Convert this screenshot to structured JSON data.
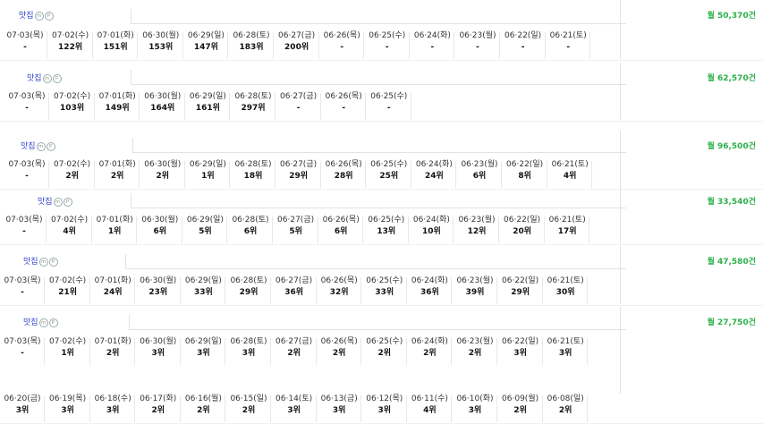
{
  "blocks": [
    {
      "keyword": "맛집",
      "badges": [
        "m",
        "P"
      ],
      "volume": "월 50,370건",
      "rows": [
        [
          [
            "07·03(목)",
            "-"
          ],
          [
            "07·02(수)",
            "122위"
          ],
          [
            "07·01(화)",
            "151위"
          ],
          [
            "06·30(월)",
            "153위"
          ],
          [
            "06·29(일)",
            "147위"
          ],
          [
            "06·28(토)",
            "183위"
          ],
          [
            "06·27(금)",
            "200위"
          ],
          [
            "06·26(목)",
            "-"
          ],
          [
            "06·25(수)",
            "-"
          ],
          [
            "06·24(화)",
            "-"
          ],
          [
            "06·23(월)",
            "-"
          ],
          [
            "06·22(일)",
            "-"
          ],
          [
            "06·21(토)",
            "-"
          ]
        ]
      ]
    },
    {
      "keyword": "맛집",
      "badges": [
        "m",
        "P"
      ],
      "volume": "월 62,570건",
      "rows": [
        [
          [
            "07·03(목)",
            "-"
          ],
          [
            "07·02(수)",
            "103위"
          ],
          [
            "07·01(화)",
            "149위"
          ],
          [
            "06·30(월)",
            "164위"
          ],
          [
            "06·29(일)",
            "161위"
          ],
          [
            "06·28(토)",
            "297위"
          ],
          [
            "06·27(금)",
            "-"
          ],
          [
            "06·26(목)",
            "-"
          ],
          [
            "06·25(수)",
            "-"
          ]
        ]
      ]
    },
    {
      "keyword": "맛집",
      "badges": [
        "m",
        "P"
      ],
      "volume": "월 96,500건",
      "rows": [
        [
          [
            "07·03(목)",
            "-"
          ],
          [
            "07·02(수)",
            "2위"
          ],
          [
            "07·01(화)",
            "2위"
          ],
          [
            "06·30(월)",
            "2위"
          ],
          [
            "06·29(일)",
            "1위"
          ],
          [
            "06·28(토)",
            "18위"
          ],
          [
            "06·27(금)",
            "29위"
          ],
          [
            "06·26(목)",
            "28위"
          ],
          [
            "06·25(수)",
            "25위"
          ],
          [
            "06·24(화)",
            "24위"
          ],
          [
            "06·23(월)",
            "6위"
          ],
          [
            "06·22(일)",
            "8위"
          ],
          [
            "06·21(토)",
            "4위"
          ]
        ]
      ]
    },
    {
      "keyword": "맛집",
      "badges": [
        "m",
        "P"
      ],
      "volume": "월 33,540건",
      "rows": [
        [
          [
            "07·03(목)",
            "-"
          ],
          [
            "07·02(수)",
            "4위"
          ],
          [
            "07·01(화)",
            "1위"
          ],
          [
            "06·30(월)",
            "6위"
          ],
          [
            "06·29(일)",
            "5위"
          ],
          [
            "06·28(토)",
            "6위"
          ],
          [
            "06·27(금)",
            "5위"
          ],
          [
            "06·26(목)",
            "6위"
          ],
          [
            "06·25(수)",
            "13위"
          ],
          [
            "06·24(화)",
            "10위"
          ],
          [
            "06·23(월)",
            "12위"
          ],
          [
            "06·22(일)",
            "20위"
          ],
          [
            "06·21(토)",
            "17위"
          ]
        ]
      ]
    },
    {
      "keyword": "맛집",
      "badges": [
        "m",
        "P"
      ],
      "volume": "월 47,580건",
      "rows": [
        [
          [
            "07·03(목)",
            "-"
          ],
          [
            "07·02(수)",
            "21위"
          ],
          [
            "07·01(화)",
            "24위"
          ],
          [
            "06·30(월)",
            "23위"
          ],
          [
            "06·29(일)",
            "33위"
          ],
          [
            "06·28(토)",
            "29위"
          ],
          [
            "06·27(금)",
            "36위"
          ],
          [
            "06·26(목)",
            "32위"
          ],
          [
            "06·25(수)",
            "33위"
          ],
          [
            "06·24(화)",
            "36위"
          ],
          [
            "06·23(월)",
            "39위"
          ],
          [
            "06·22(일)",
            "29위"
          ],
          [
            "06·21(토)",
            "30위"
          ]
        ]
      ]
    },
    {
      "keyword": "맛집",
      "badges": [
        "m",
        "P"
      ],
      "volume": "월 27,750건",
      "rows": [
        [
          [
            "07·03(목)",
            "-"
          ],
          [
            "07·02(수)",
            "1위"
          ],
          [
            "07·01(화)",
            "2위"
          ],
          [
            "06·30(월)",
            "3위"
          ],
          [
            "06·29(일)",
            "3위"
          ],
          [
            "06·28(토)",
            "3위"
          ],
          [
            "06·27(금)",
            "2위"
          ],
          [
            "06·26(목)",
            "2위"
          ],
          [
            "06·25(수)",
            "2위"
          ],
          [
            "06·24(화)",
            "2위"
          ],
          [
            "06·23(월)",
            "2위"
          ],
          [
            "06·22(일)",
            "3위"
          ],
          [
            "06·21(토)",
            "3위"
          ]
        ],
        [
          [
            "06·20(금)",
            "3위"
          ],
          [
            "06·19(목)",
            "3위"
          ],
          [
            "06·18(수)",
            "3위"
          ],
          [
            "06·17(화)",
            "2위"
          ],
          [
            "06·16(월)",
            "2위"
          ],
          [
            "06·15(일)",
            "2위"
          ],
          [
            "06·14(토)",
            "3위"
          ],
          [
            "06·13(금)",
            "3위"
          ],
          [
            "06·12(목)",
            "3위"
          ],
          [
            "06·11(수)",
            "4위"
          ],
          [
            "06·10(화)",
            "3위"
          ],
          [
            "06·09(월)",
            "2위"
          ],
          [
            "06·08(일)",
            "2위"
          ]
        ]
      ]
    }
  ]
}
